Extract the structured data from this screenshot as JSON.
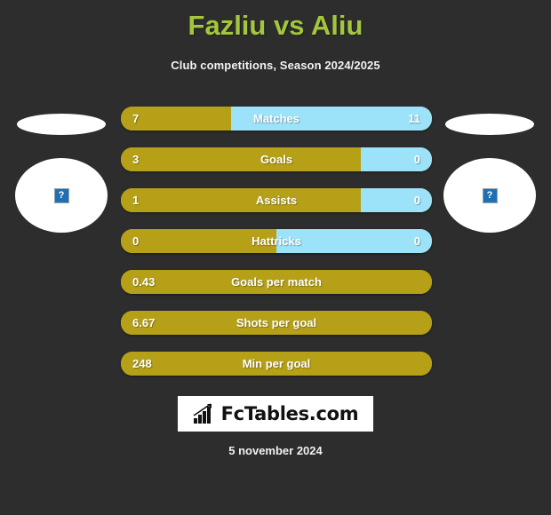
{
  "header": {
    "title": "Fazliu vs Aliu",
    "subtitle": "Club competitions, Season 2024/2025",
    "title_color": "#a4c63c"
  },
  "players": {
    "left": {
      "photo_placeholder": "?",
      "flag_placeholder": ""
    },
    "right": {
      "photo_placeholder": "?",
      "flag_placeholder": ""
    }
  },
  "colors": {
    "background": "#2d2d2d",
    "player_one_bar": "#b5a018",
    "player_two_bar": "#9ce2f8",
    "label_text": "#ffffff"
  },
  "stats": [
    {
      "label": "Matches",
      "left_value": "7",
      "right_value": "11",
      "left_pct": 35.3,
      "dual": true
    },
    {
      "label": "Goals",
      "left_value": "3",
      "right_value": "0",
      "left_pct": 77.0,
      "dual": true
    },
    {
      "label": "Assists",
      "left_value": "1",
      "right_value": "0",
      "left_pct": 77.0,
      "dual": true
    },
    {
      "label": "Hattricks",
      "left_value": "0",
      "right_value": "0",
      "left_pct": 50.0,
      "dual": true
    },
    {
      "label": "Goals per match",
      "left_value": "0.43",
      "right_value": "",
      "left_pct": 100.0,
      "dual": false
    },
    {
      "label": "Shots per goal",
      "left_value": "6.67",
      "right_value": "",
      "left_pct": 100.0,
      "dual": false
    },
    {
      "label": "Min per goal",
      "left_value": "248",
      "right_value": "",
      "left_pct": 100.0,
      "dual": false
    }
  ],
  "footer": {
    "logo_text": "FcTables.com",
    "logo_icon": "bar-chart-icon",
    "date": "5 november 2024"
  }
}
